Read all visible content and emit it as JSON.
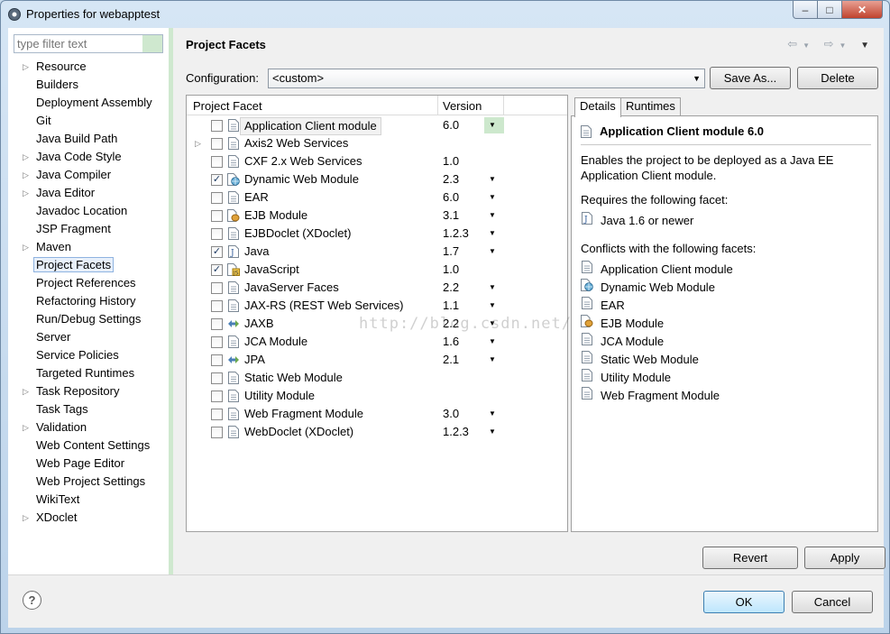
{
  "window": {
    "title": "Properties for webapptest",
    "min": "–",
    "max": "□",
    "close": "✕"
  },
  "nav": {
    "filter_placeholder": "type filter text",
    "items": [
      {
        "label": "Resource",
        "expandable": true
      },
      {
        "label": "Builders",
        "expandable": false
      },
      {
        "label": "Deployment Assembly",
        "expandable": false
      },
      {
        "label": "Git",
        "expandable": false
      },
      {
        "label": "Java Build Path",
        "expandable": false
      },
      {
        "label": "Java Code Style",
        "expandable": true
      },
      {
        "label": "Java Compiler",
        "expandable": true
      },
      {
        "label": "Java Editor",
        "expandable": true
      },
      {
        "label": "Javadoc Location",
        "expandable": false
      },
      {
        "label": "JSP Fragment",
        "expandable": false
      },
      {
        "label": "Maven",
        "expandable": true
      },
      {
        "label": "Project Facets",
        "expandable": false,
        "selected": true
      },
      {
        "label": "Project References",
        "expandable": false
      },
      {
        "label": "Refactoring History",
        "expandable": false
      },
      {
        "label": "Run/Debug Settings",
        "expandable": false
      },
      {
        "label": "Server",
        "expandable": false
      },
      {
        "label": "Service Policies",
        "expandable": false
      },
      {
        "label": "Targeted Runtimes",
        "expandable": false
      },
      {
        "label": "Task Repository",
        "expandable": true
      },
      {
        "label": "Task Tags",
        "expandable": false
      },
      {
        "label": "Validation",
        "expandable": true
      },
      {
        "label": "Web Content Settings",
        "expandable": false
      },
      {
        "label": "Web Page Editor",
        "expandable": false
      },
      {
        "label": "Web Project Settings",
        "expandable": false
      },
      {
        "label": "WikiText",
        "expandable": false
      },
      {
        "label": "XDoclet",
        "expandable": true
      }
    ]
  },
  "main": {
    "title": "Project Facets",
    "configuration_label": "Configuration:",
    "configuration_value": "<custom>",
    "save_as": "Save As...",
    "delete": "Delete",
    "col_facet": "Project Facet",
    "col_version": "Version",
    "facets": [
      {
        "name": "Application Client module",
        "version": "6.0",
        "checked": false,
        "dropdown": true,
        "selected": true,
        "icon": "page-icon"
      },
      {
        "name": "Axis2 Web Services",
        "version": "",
        "checked": false,
        "dropdown": false,
        "expandable": true,
        "icon": "page-icon"
      },
      {
        "name": "CXF 2.x Web Services",
        "version": "1.0",
        "checked": false,
        "dropdown": false,
        "icon": "page-icon"
      },
      {
        "name": "Dynamic Web Module",
        "version": "2.3",
        "checked": true,
        "dropdown": true,
        "icon": "globe-icon"
      },
      {
        "name": "EAR",
        "version": "6.0",
        "checked": false,
        "dropdown": true,
        "icon": "page-icon"
      },
      {
        "name": "EJB Module",
        "version": "3.1",
        "checked": false,
        "dropdown": true,
        "icon": "bean-icon"
      },
      {
        "name": "EJBDoclet (XDoclet)",
        "version": "1.2.3",
        "checked": false,
        "dropdown": true,
        "icon": "page-icon"
      },
      {
        "name": "Java",
        "version": "1.7",
        "checked": true,
        "dropdown": true,
        "icon": "java-icon"
      },
      {
        "name": "JavaScript",
        "version": "1.0",
        "checked": true,
        "dropdown": false,
        "icon": "script-icon"
      },
      {
        "name": "JavaServer Faces",
        "version": "2.2",
        "checked": false,
        "dropdown": true,
        "icon": "page-icon"
      },
      {
        "name": "JAX-RS (REST Web Services)",
        "version": "1.1",
        "checked": false,
        "dropdown": true,
        "icon": "page-icon"
      },
      {
        "name": "JAXB",
        "version": "2.2",
        "checked": false,
        "dropdown": true,
        "icon": "arrows-icon"
      },
      {
        "name": "JCA Module",
        "version": "1.6",
        "checked": false,
        "dropdown": true,
        "icon": "page-icon"
      },
      {
        "name": "JPA",
        "version": "2.1",
        "checked": false,
        "dropdown": true,
        "icon": "arrows-icon"
      },
      {
        "name": "Static Web Module",
        "version": "",
        "checked": false,
        "dropdown": false,
        "icon": "page-icon"
      },
      {
        "name": "Utility Module",
        "version": "",
        "checked": false,
        "dropdown": false,
        "icon": "page-icon"
      },
      {
        "name": "Web Fragment Module",
        "version": "3.0",
        "checked": false,
        "dropdown": true,
        "icon": "page-icon"
      },
      {
        "name": "WebDoclet (XDoclet)",
        "version": "1.2.3",
        "checked": false,
        "dropdown": true,
        "icon": "page-icon"
      }
    ]
  },
  "details": {
    "tab_details": "Details",
    "tab_runtimes": "Runtimes",
    "title": "Application Client module 6.0",
    "description": "Enables the project to be deployed as a Java EE Application Client module.",
    "requires_label": "Requires the following facet:",
    "requires": [
      {
        "name": "Java 1.6 or newer",
        "icon": "java-icon"
      }
    ],
    "conflicts_label": "Conflicts with the following facets:",
    "conflicts": [
      {
        "name": "Application Client module",
        "icon": "page-icon"
      },
      {
        "name": "Dynamic Web Module",
        "icon": "globe-icon"
      },
      {
        "name": "EAR",
        "icon": "page-icon"
      },
      {
        "name": "EJB Module",
        "icon": "bean-icon"
      },
      {
        "name": "JCA Module",
        "icon": "page-icon"
      },
      {
        "name": "Static Web Module",
        "icon": "page-icon"
      },
      {
        "name": "Utility Module",
        "icon": "page-icon"
      },
      {
        "name": "Web Fragment Module",
        "icon": "page-icon"
      }
    ]
  },
  "watermark": "http://blog.csdn.net/",
  "buttons": {
    "revert": "Revert",
    "apply": "Apply",
    "ok": "OK",
    "cancel": "Cancel",
    "help": "?"
  }
}
